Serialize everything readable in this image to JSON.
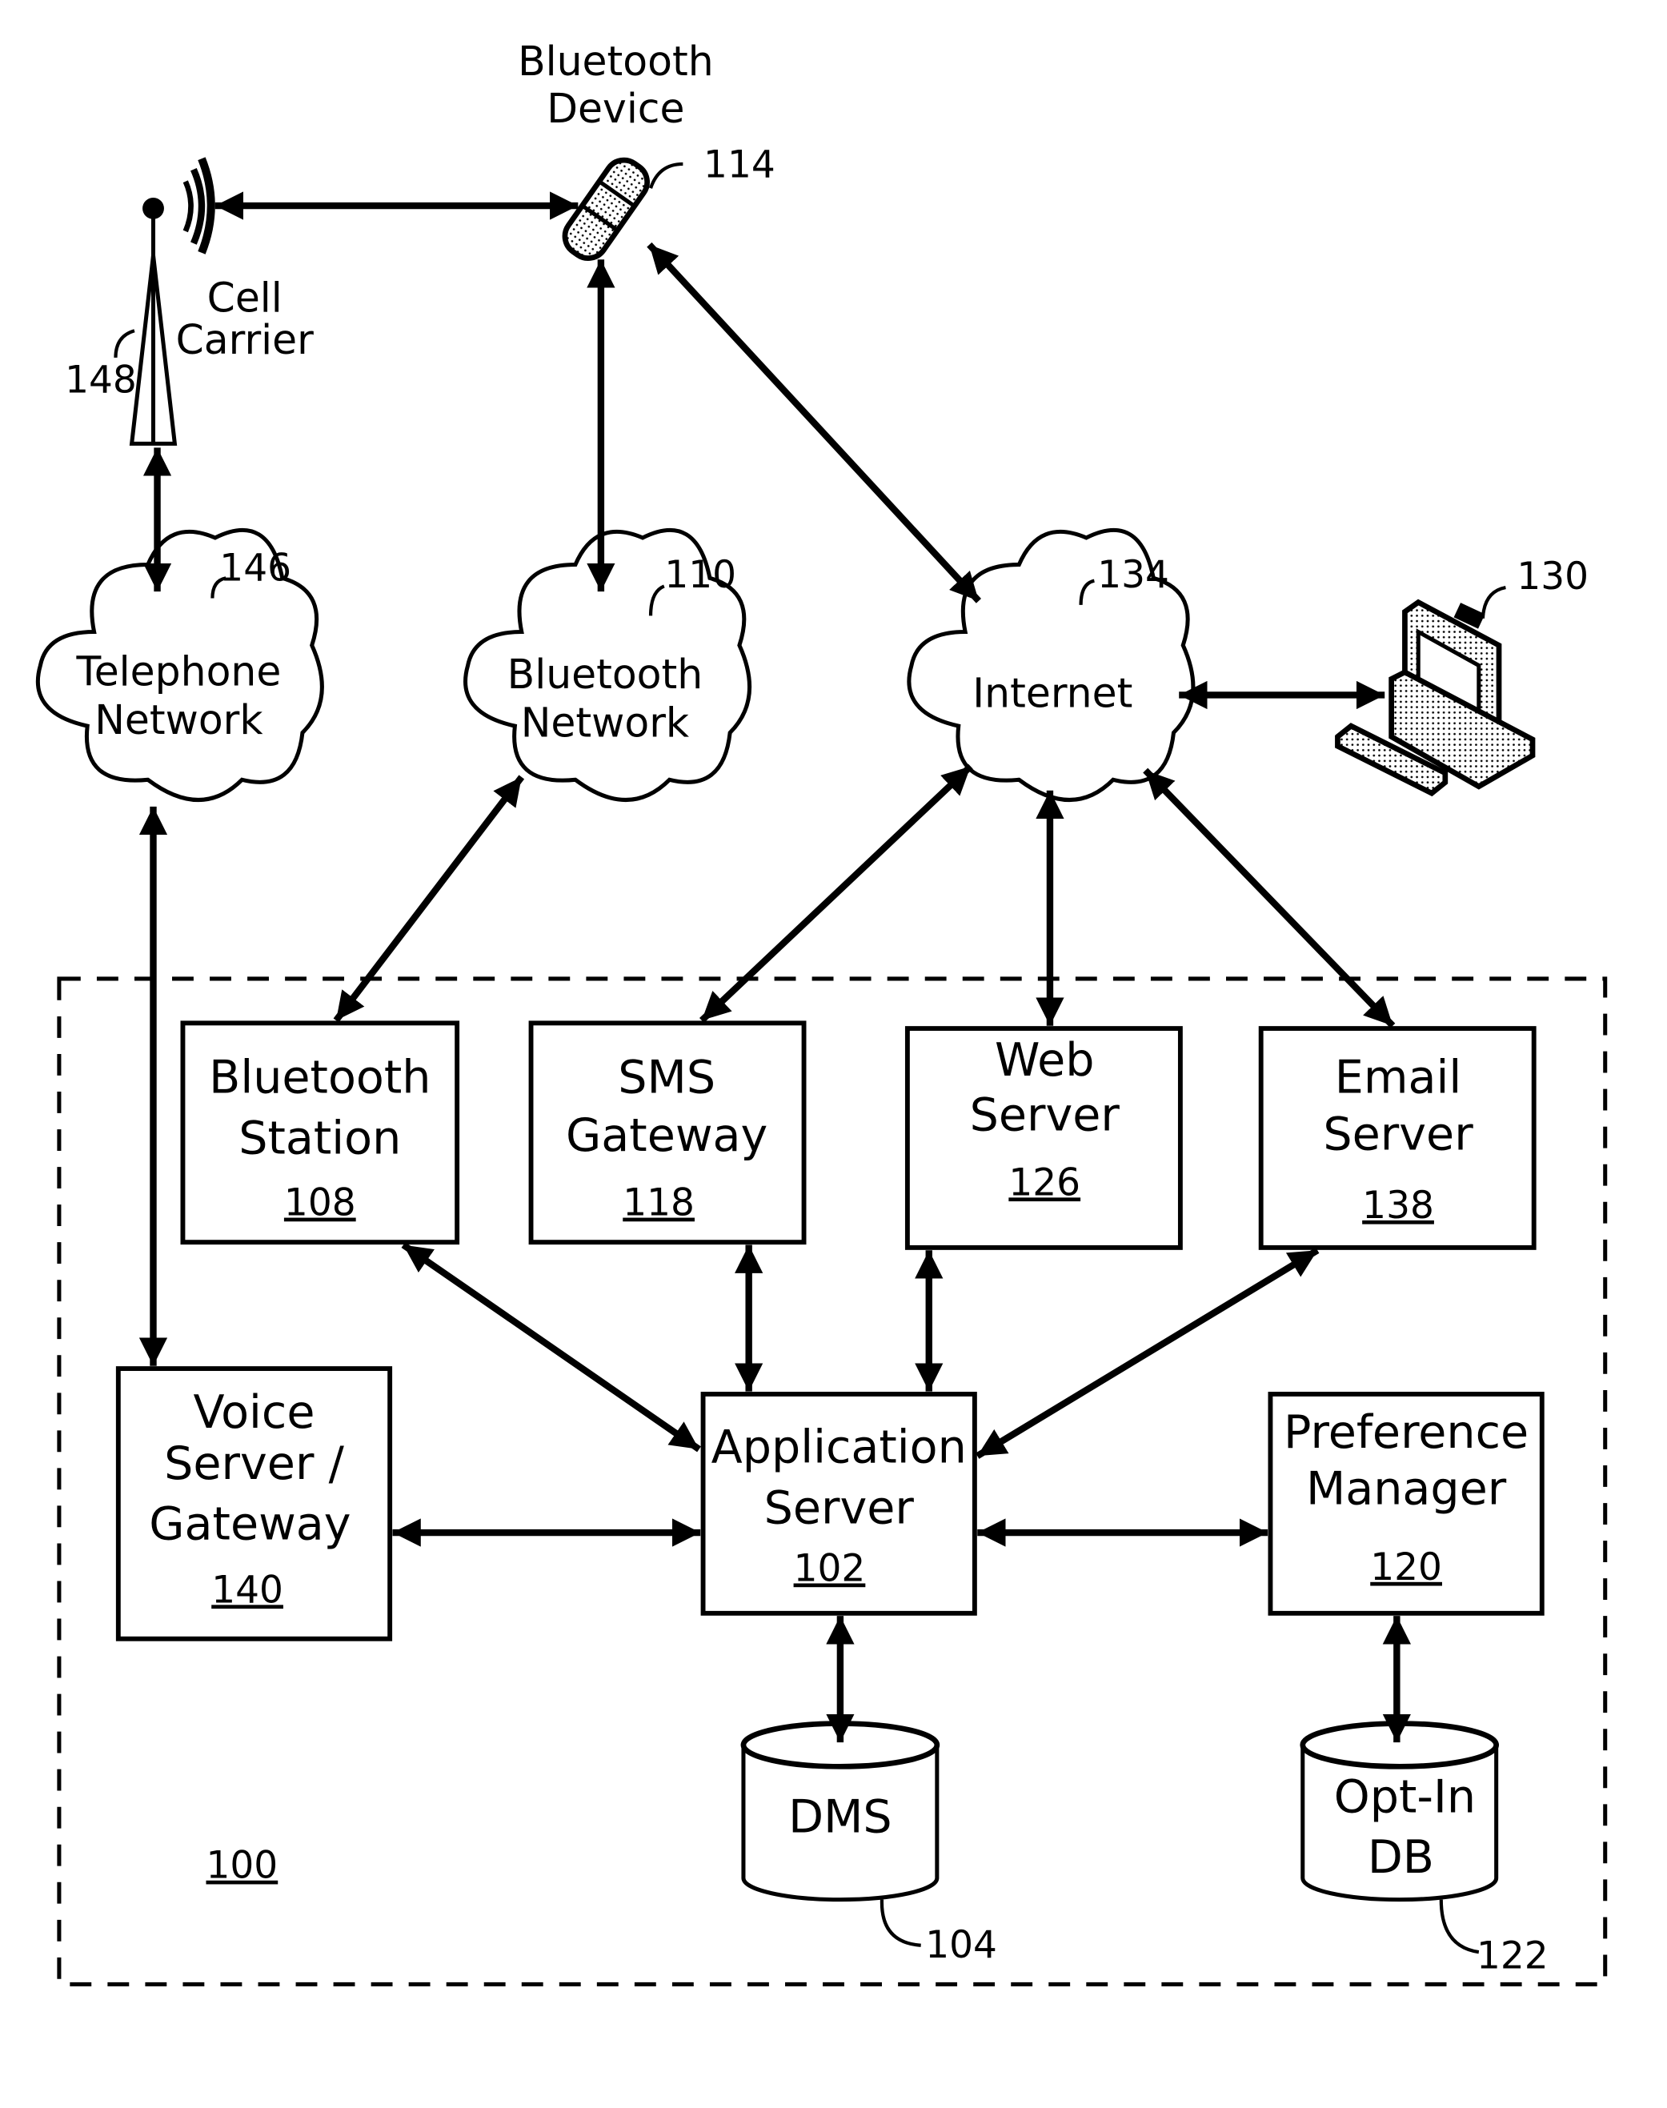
{
  "diagram": {
    "system": {
      "ref": "100"
    },
    "external": {
      "bluetooth_device": {
        "label_line1": "Bluetooth",
        "label_line2": "Device",
        "ref": "114"
      },
      "cell_carrier": {
        "label_line1": "Cell",
        "label_line2": "Carrier",
        "ref": "148"
      },
      "telephone_network": {
        "label_line1": "Telephone",
        "label_line2": "Network",
        "ref": "146"
      },
      "bluetooth_network": {
        "label_line1": "Bluetooth",
        "label_line2": "Network",
        "ref": "110"
      },
      "internet": {
        "label": "Internet",
        "ref": "134"
      },
      "computer": {
        "ref": "130"
      }
    },
    "components": {
      "bluetooth_station": {
        "line1": "Bluetooth",
        "line2": "Station",
        "ref": "108"
      },
      "sms_gateway": {
        "line1": "SMS",
        "line2": "Gateway",
        "ref": "118"
      },
      "web_server": {
        "line1": "Web",
        "line2": "Server",
        "ref": "126"
      },
      "email_server": {
        "line1": "Email",
        "line2": "Server",
        "ref": "138"
      },
      "voice_server": {
        "line1": "Voice",
        "line2": "Server /",
        "line3": "Gateway",
        "ref": "140"
      },
      "application_server": {
        "line1": "Application",
        "line2": "Server",
        "ref": "102"
      },
      "preference_manager": {
        "line1": "Preference",
        "line2": "Manager",
        "ref": "120"
      },
      "dms": {
        "label": "DMS",
        "ref": "104"
      },
      "opt_in_db": {
        "line1": "Opt-In",
        "line2": "DB",
        "ref": "122"
      }
    },
    "connections": [
      {
        "from": "cell_carrier",
        "to": "bluetooth_device"
      },
      {
        "from": "bluetooth_device",
        "to": "bluetooth_network"
      },
      {
        "from": "bluetooth_device",
        "to": "internet"
      },
      {
        "from": "cell_carrier",
        "to": "telephone_network"
      },
      {
        "from": "internet",
        "to": "computer"
      },
      {
        "from": "telephone_network",
        "to": "voice_server"
      },
      {
        "from": "bluetooth_network",
        "to": "bluetooth_station"
      },
      {
        "from": "internet",
        "to": "sms_gateway"
      },
      {
        "from": "internet",
        "to": "web_server"
      },
      {
        "from": "internet",
        "to": "email_server"
      },
      {
        "from": "bluetooth_station",
        "to": "application_server"
      },
      {
        "from": "sms_gateway",
        "to": "application_server"
      },
      {
        "from": "web_server",
        "to": "application_server"
      },
      {
        "from": "email_server",
        "to": "application_server"
      },
      {
        "from": "voice_server",
        "to": "application_server"
      },
      {
        "from": "application_server",
        "to": "preference_manager"
      },
      {
        "from": "application_server",
        "to": "dms"
      },
      {
        "from": "preference_manager",
        "to": "opt_in_db"
      }
    ]
  }
}
